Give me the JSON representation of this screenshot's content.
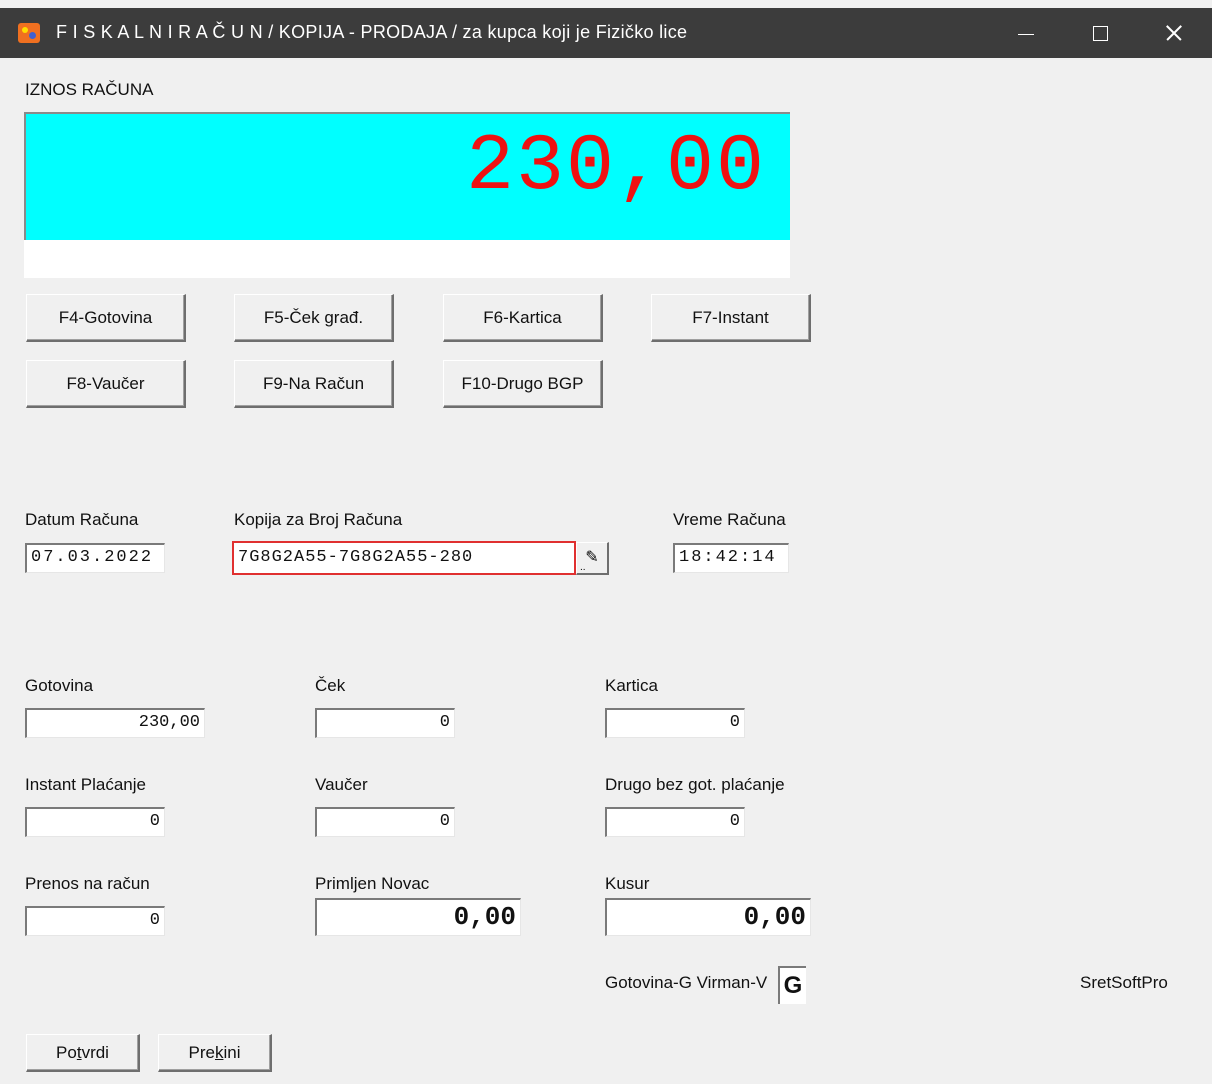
{
  "window": {
    "title": "F I S K A L N I  R A Č U N / KOPIJA - PRODAJA / za kupca koji je Fizičko lice",
    "minimize_glyph": "",
    "maximize_glyph": "",
    "close_glyph": ""
  },
  "amount": {
    "label": "IZNOS RAČUNA",
    "value": "230,00",
    "value_color": "#ee1111",
    "bg_color": "#00ffff"
  },
  "payment_buttons": {
    "f4": "F4-Gotovina",
    "f5": "F5-Ček građ.",
    "f6": "F6-Kartica",
    "f7": "F7-Instant",
    "f8": "F8-Vaučer",
    "f9": "F9-Na Račun",
    "f10": "F10-Drugo BGP"
  },
  "invoice": {
    "date_label": "Datum Računa",
    "date_value": "07.03.2022",
    "copy_label": "Kopija za Broj Računa",
    "copy_value": "7G8G2A55-7G8G2A55-280",
    "time_label": "Vreme Računa",
    "time_value": "18:42:14"
  },
  "payments": {
    "gotovina_label": "Gotovina",
    "gotovina_value": "230,00",
    "cek_label": "Ček",
    "cek_value": "0",
    "kartica_label": "Kartica",
    "kartica_value": "0",
    "instant_label": "Instant Plaćanje",
    "instant_value": "0",
    "vaucer_label": "Vaučer",
    "vaucer_value": "0",
    "drugo_label": "Drugo bez got. plaćanje",
    "drugo_value": "0",
    "prenos_label": "Prenos na račun",
    "prenos_value": "0",
    "primljen_label": "Primljen Novac",
    "primljen_value": "0,00",
    "kusur_label": "Kusur",
    "kusur_value": "0,00"
  },
  "mode": {
    "label": "Gotovina-G Virman-V",
    "value": "G"
  },
  "brand": "SretSoftPro",
  "actions": {
    "confirm_pre": "Po",
    "confirm_u": "t",
    "confirm_post": "vrdi",
    "cancel_pre": "Pre",
    "cancel_u": "k",
    "cancel_post": "ini"
  }
}
